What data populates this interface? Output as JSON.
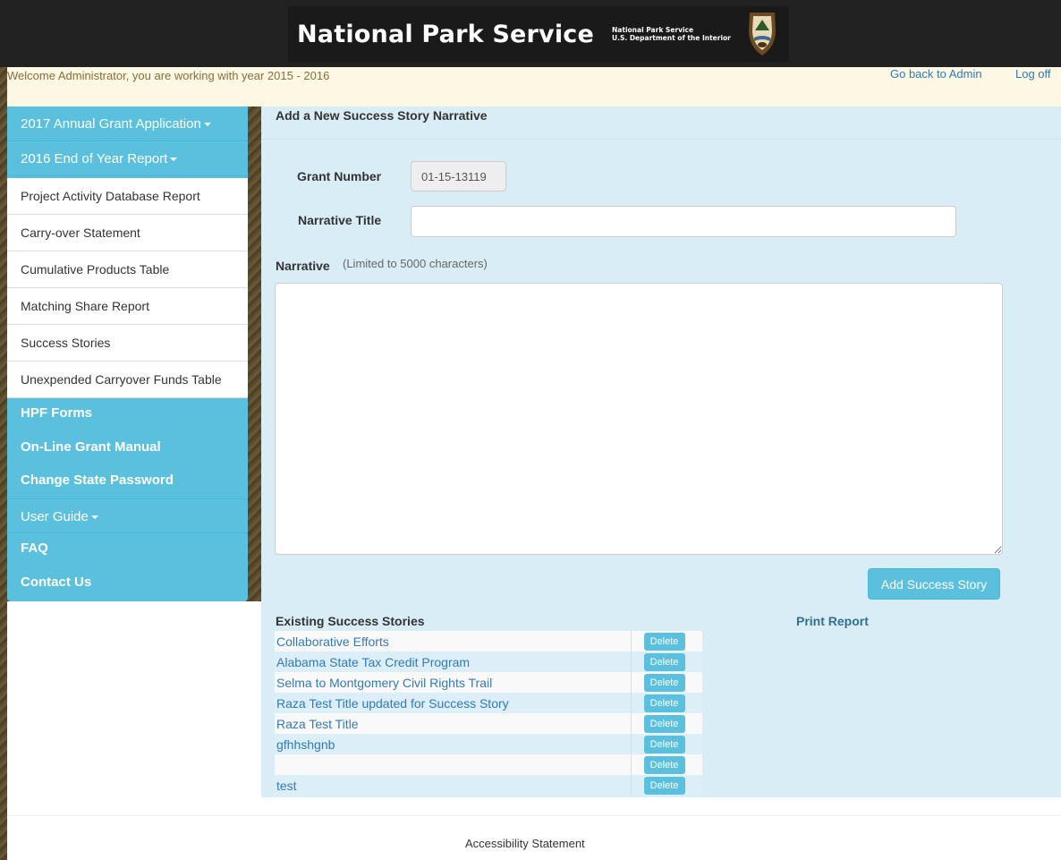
{
  "banner": {
    "title": "National Park Service",
    "subtitle_line1": "National Park Service",
    "subtitle_line2": "U.S. Department of the Interior",
    "logo_icon": "nps-arrowhead-icon"
  },
  "welcome": {
    "text": "Welcome Administrator, you are working with year 2015 - 2016",
    "back_link": "Go back to Admin",
    "logoff_link": "Log off"
  },
  "sidebar": {
    "dropdown_2017": "2017 Annual Grant Application",
    "dropdown_2016": "2016 End of Year Report",
    "items": [
      "Project Activity Database Report",
      "Carry-over Statement",
      "Cumulative Products Table",
      "Matching Share Report",
      "Success Stories",
      "Unexpended Carryover Funds Table"
    ],
    "hpf_forms": "HPF Forms",
    "grant_manual": "On-Line Grant Manual",
    "change_password": "Change State Password",
    "user_guide": "User Guide",
    "faq": "FAQ",
    "contact": "Contact Us"
  },
  "form": {
    "heading": "Add a New Success Story Narrative",
    "grant_label": "Grant Number",
    "grant_value": "01-15-13119",
    "title_label": "Narrative Title",
    "title_value": "",
    "narrative_label": "Narrative",
    "narrative_hint": "(Limited to 5000 characters)",
    "narrative_value": "",
    "add_button": "Add Success Story"
  },
  "stories": {
    "heading": "Existing Success Stories",
    "print_link": "Print Report",
    "delete_label": "Delete",
    "rows": [
      "Collaborative Efforts",
      "Alabama State Tax Credit Program",
      "Selma to Montgomery Civil Rights Trail",
      "Raza Test Title updated for Success Story",
      "Raza Test Title",
      "gfhhshgnb",
      "",
      "test"
    ]
  },
  "footer": {
    "accessibility": "Accessibility Statement"
  },
  "colors": {
    "accent": "#5bc0de",
    "panel": "#d9edf7",
    "welcome_bg": "#fcf8e3",
    "banner_bg": "#222222"
  }
}
